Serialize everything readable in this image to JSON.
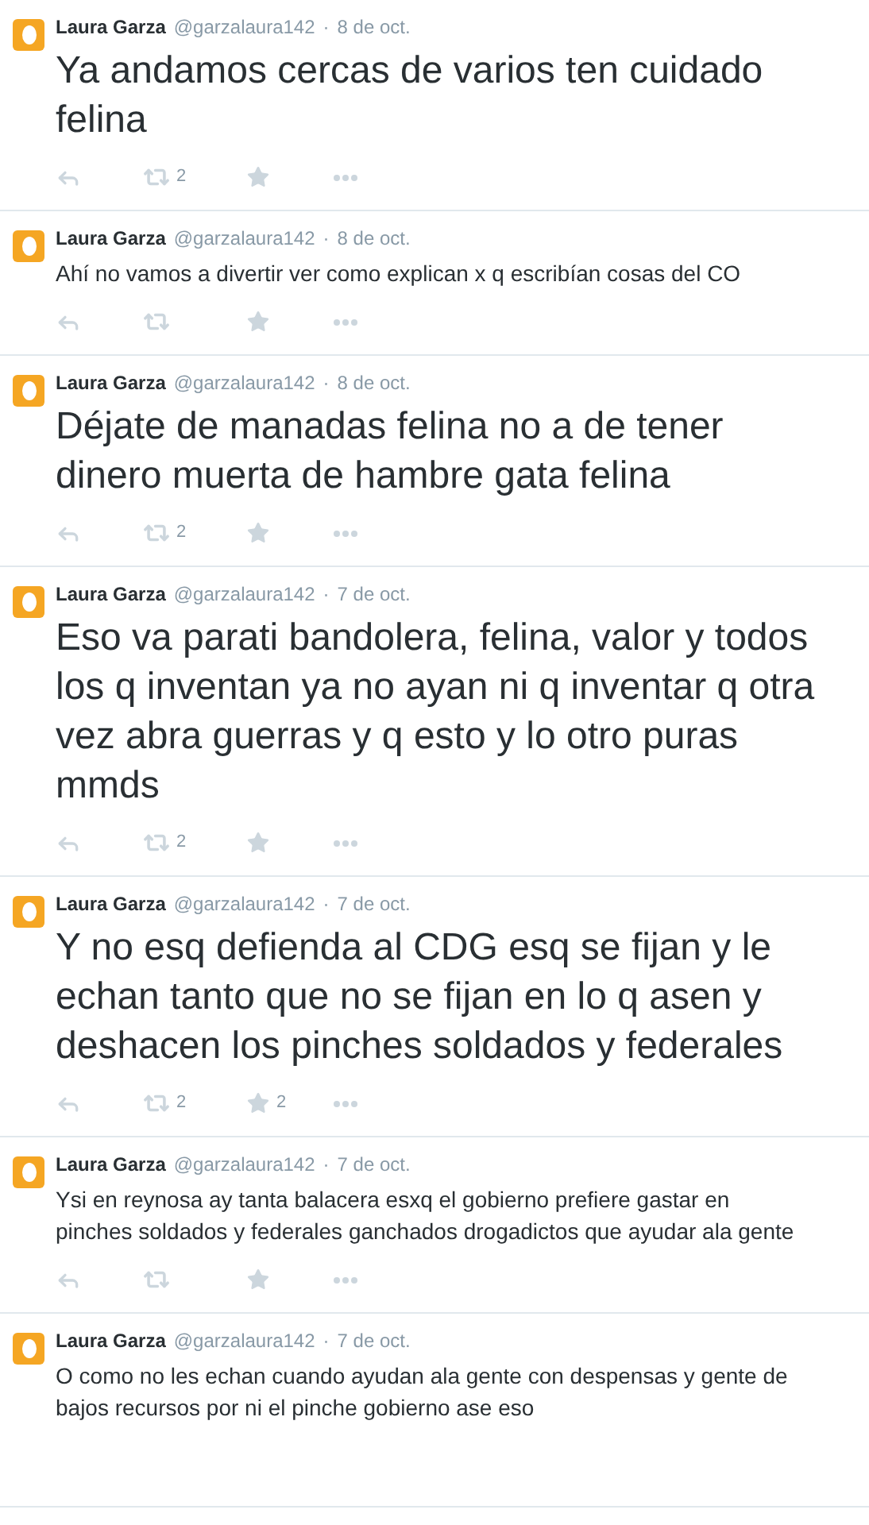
{
  "separator": "·",
  "tweets": [
    {
      "name": "Laura Garza",
      "handle": "@garzalaura142",
      "date": "8 de oct.",
      "kind": "large",
      "text": "Ya andamos cercas de varios ten cuidado felina",
      "retweets": "2",
      "actions": true
    },
    {
      "name": "Laura Garza",
      "handle": "@garzalaura142",
      "date": "8 de oct.",
      "kind": "small",
      "text": "Ahí no vamos a divertir ver como explican x q escribían cosas del CO",
      "actions": true
    },
    {
      "name": "Laura Garza",
      "handle": "@garzalaura142",
      "date": "8 de oct.",
      "kind": "large",
      "text": "Déjate de manadas felina no a de tener dinero muerta de hambre gata felina",
      "retweets": "2",
      "actions": true
    },
    {
      "name": "Laura Garza",
      "handle": "@garzalaura142",
      "date": "7 de oct.",
      "kind": "large",
      "text": "Eso va parati bandolera, felina, valor y todos los q inventan ya no ayan ni q inventar q otra vez abra guerras y q esto y lo otro puras mmds",
      "retweets": "2",
      "actions": true
    },
    {
      "name": "Laura Garza",
      "handle": "@garzalaura142",
      "date": "7 de oct.",
      "kind": "large",
      "text": "Y no esq defienda al CDG esq se fijan y le echan tanto que no se fijan en lo q asen y deshacen los pinches soldados y federales",
      "retweets": "2",
      "favorites": "2",
      "actions": true
    },
    {
      "name": "Laura Garza",
      "handle": "@garzalaura142",
      "date": "7 de oct.",
      "kind": "small",
      "text": "Ysi en reynosa ay tanta balacera esxq el gobierno prefiere gastar en pinches soldados y federales ganchados drogadictos que ayudar ala gente",
      "actions": true
    },
    {
      "name": "Laura Garza",
      "handle": "@garzalaura142",
      "date": "7 de oct.",
      "kind": "small",
      "text": "O como no les echan cuando ayudan ala gente con despensas y gente de bajos recursos por ni el pinche gobierno ase eso",
      "actions": false
    }
  ]
}
